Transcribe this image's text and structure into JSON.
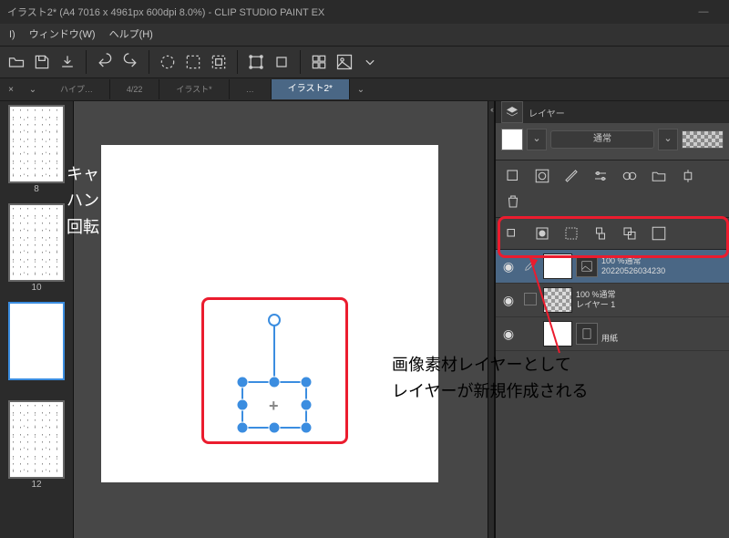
{
  "title": "イラスト2* (A4 7016 x 4961px 600dpi 8.0%)   - CLIP STUDIO PAINT EX",
  "menu": {
    "i": "I)",
    "window": "ウィンドウ(W)",
    "help": "ヘルプ(H)"
  },
  "tabs": {
    "list": [
      "ハイプ…",
      "4/22",
      "イラスト*",
      "…",
      "イラスト2*"
    ],
    "activeIndex": 4
  },
  "pages": {
    "numbers": [
      "8",
      "10",
      "",
      "12"
    ]
  },
  "layerPanel": {
    "tabLabel": "レイヤー",
    "blend": "通常",
    "layers": [
      {
        "thumb": "image",
        "name": "20220526034230",
        "opacity": "100 %通常",
        "selected": true,
        "mode": "pen"
      },
      {
        "thumb": "checker",
        "name": "レイヤー 1",
        "opacity": "100 %通常",
        "selected": false,
        "mode": "box"
      },
      {
        "thumb": "solid",
        "name": "用紙",
        "opacity": "",
        "selected": false,
        "mode": "none"
      }
    ]
  },
  "annot": {
    "canvas1": "キャンバスに画像が張り付く",
    "canvas2": "ハンドルをドラッグして",
    "canvas3": "回転・拡大縮小が可能",
    "layer1": "画像素材レイヤーとして",
    "layer2": "レイヤーが新規作成される"
  }
}
